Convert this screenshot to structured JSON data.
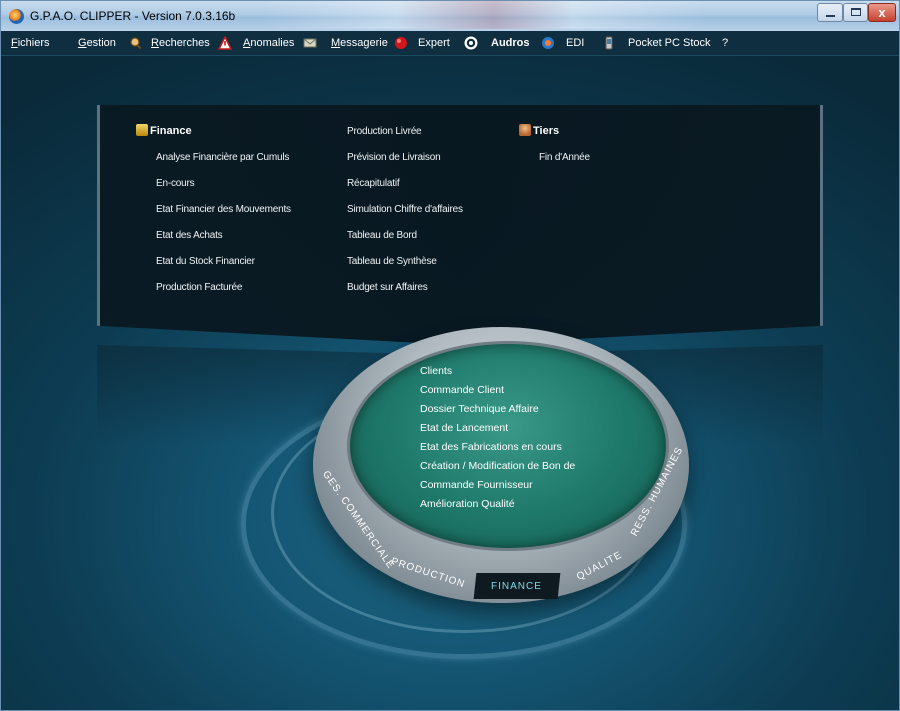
{
  "window": {
    "title": "G.P.A.O. CLIPPER - Version 7.0.3.16b",
    "close_glyph": "x"
  },
  "menu": {
    "items": [
      {
        "label": "Fichiers",
        "icon": null
      },
      {
        "label": "Gestion",
        "icon": null
      },
      {
        "label": "Recherches",
        "icon": "search-icon"
      },
      {
        "label": "Anomalies",
        "icon": "warning-icon"
      },
      {
        "label": "Messagerie",
        "icon": "messaging-icon"
      },
      {
        "label": "Expert",
        "icon": "expert-icon"
      },
      {
        "label": "Audros",
        "icon": "audros-icon"
      },
      {
        "label": "EDI",
        "icon": "edi-icon"
      },
      {
        "label": "Pocket PC Stock",
        "icon": "pocket-pc-icon"
      },
      {
        "label": "?",
        "icon": null
      }
    ]
  },
  "panel": {
    "categories": {
      "finance": "Finance",
      "tiers": "Tiers"
    },
    "finance_col1": [
      "Analyse Financière par Cumuls",
      "En-cours",
      "Etat Financier des Mouvements",
      "Etat des Achats",
      "Etat du Stock Financier",
      "Production Facturée"
    ],
    "finance_col2": [
      "Production Livrée",
      "Prévision de Livraison",
      "Récapitulatif",
      "Simulation Chiffre d'affaires",
      "Tableau de Bord",
      "Tableau de Synthèse",
      "Budget sur Affaires"
    ],
    "tiers_items": [
      "Fin d'Année"
    ]
  },
  "wheel": {
    "items": [
      "Clients",
      "Commande Client",
      "Dossier Technique Affaire",
      "Etat de Lancement",
      "Etat des Fabrications en cours",
      "Création / Modification de Bon de",
      "Commande Fournisseur",
      "Amélioration Qualité"
    ],
    "segments": {
      "ges_commerciale": "GES. COMMERCIALE",
      "production": "PRODUCTION",
      "finance": "FINANCE",
      "qualite": "QUALITE",
      "ress_humaines": "RESS. HUMAINES"
    },
    "active_segment": "FINANCE"
  },
  "colors": {
    "menubar_bg": "#0f2e40",
    "active_segment_text": "#7ed9e6",
    "wheel_center": "#1f7a6b"
  }
}
